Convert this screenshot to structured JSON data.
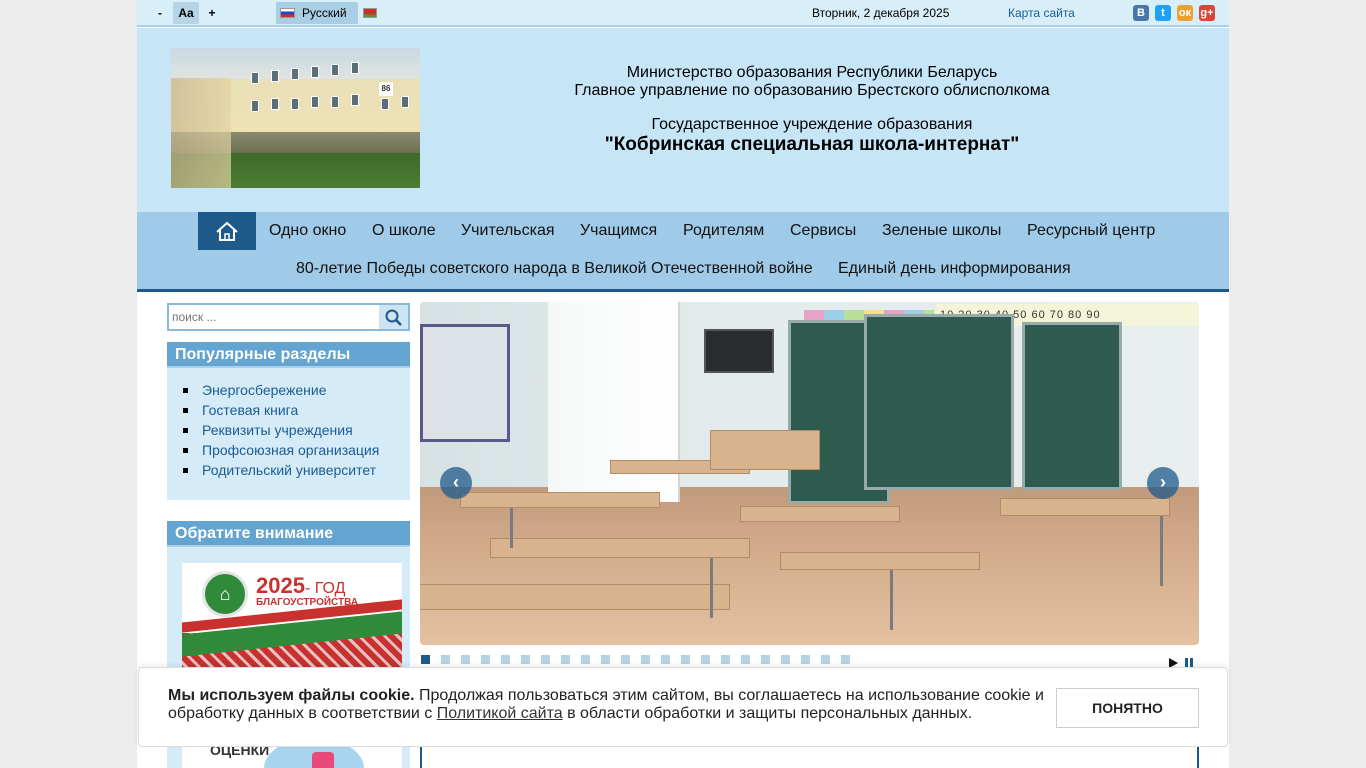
{
  "topbar": {
    "font_minus": "-",
    "font_normal": "Aa",
    "font_plus": "+",
    "language": "Русский",
    "date": "Вторник, 2 декабря 2025",
    "sitemap": "Карта сайта",
    "social": {
      "vk": "В",
      "twitter": "t",
      "ok": "ок",
      "gplus": "g+"
    }
  },
  "header": {
    "line1": "Министерство образования Республики Беларусь",
    "line2": "Главное управление по образованию Брестского облисполкома",
    "line3": "Государственное учреждение образования",
    "line4": "\"Кобринская специальная школа-интернат\"",
    "building_number": "86"
  },
  "nav": {
    "row1": [
      "Одно окно",
      "О школе",
      "Учительская",
      "Учащимся",
      "Родителям",
      "Сервисы",
      "Зеленые школы",
      "Ресурсный центр"
    ],
    "row2": [
      "80-летие Победы советского народа в Великой Отечественной войне",
      "Единый день информирования"
    ]
  },
  "search": {
    "placeholder": "поиск ..."
  },
  "popular": {
    "title": "Популярные разделы",
    "items": [
      "Энергосбережение",
      "Гостевая книга",
      "Реквизиты учреждения",
      "Профсоюзная организация",
      "Родительский университет"
    ]
  },
  "attention": {
    "title": "Обратите внимание",
    "banner_year": "2025",
    "banner_year_suffix": "- ГОД",
    "banner_sub": "БЛАГОУСТРОЙСТВА",
    "banner2_text": "ОЦЕНКИ"
  },
  "slider": {
    "numbers_strip": "10 20 30 40 50 60 70 80 90",
    "dot_count": 22,
    "active_dot": 0
  },
  "cookie": {
    "bold": "Мы используем файлы cookie.",
    "text1": " Продолжая пользоваться этим сайтом, вы соглашаетесь на использование cookie и обработку данных в соответствии с ",
    "link": "Политикой сайта",
    "text2": " в области обработки и защиты персональных данных.",
    "button": "ПОНЯТНО"
  },
  "colors": {
    "accent": "#1d5a8a",
    "nav_bg": "#9fcbe8",
    "header_bg": "#c6e6f8",
    "box_head": "#64a4d0"
  }
}
